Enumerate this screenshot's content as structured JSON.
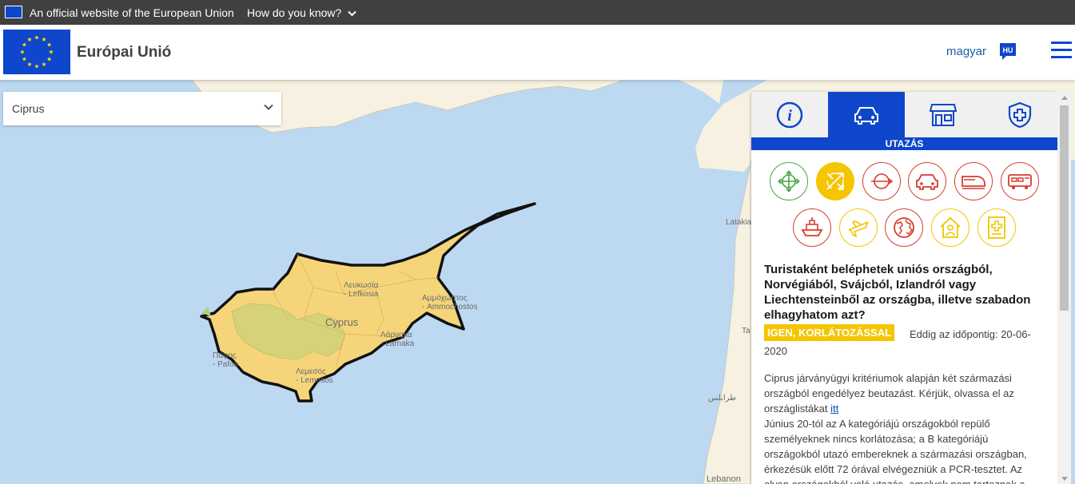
{
  "topbar": {
    "official_text": "An official website of the European Union",
    "how_know": "How do you know?"
  },
  "header": {
    "site_title": "Európai Unió",
    "language": "magyar",
    "language_code": "HU"
  },
  "country_select": {
    "value": "Ciprus"
  },
  "map": {
    "labels": {
      "nicosia": "Λευκωσία\n- Lefkosia",
      "famagusta": "Αμμόχωστος\n- Ammochostos",
      "cyprus": "Cyprus",
      "larnaca": "Λάρνακα\n- Larnaka",
      "paphos": "Πάφος\n- Pafos",
      "limassol": "Λεμεσός\n- Lemesos",
      "latakia": "Latakia",
      "tartus_fragment": "Ta",
      "tripoli_fragment": "طرابلس",
      "lebanon": "Lebanon"
    },
    "colors": {
      "sea": "#bcd9f1",
      "land": "#f6f1e1",
      "highlight": "#f6d57a",
      "forest": "#d6d27a",
      "border": "#111111"
    }
  },
  "panel": {
    "tabs": [
      {
        "name": "info",
        "icon": "info-icon"
      },
      {
        "name": "travel",
        "icon": "car-icon",
        "active": true
      },
      {
        "name": "shops",
        "icon": "store-icon"
      },
      {
        "name": "health",
        "icon": "health-shield-icon"
      }
    ],
    "section_title": "UTAZÁS",
    "categories": [
      {
        "icon": "move-arrows-icon",
        "color": "green"
      },
      {
        "icon": "crossing-arrows-icon",
        "color": "yellow",
        "selected": true
      },
      {
        "icon": "transit-icon",
        "color": "red"
      },
      {
        "icon": "car-icon",
        "color": "red"
      },
      {
        "icon": "train-icon",
        "color": "red"
      },
      {
        "icon": "bus-icon",
        "color": "red"
      },
      {
        "icon": "ship-icon",
        "color": "red"
      },
      {
        "icon": "plane-icon",
        "color": "yellow"
      },
      {
        "icon": "globe-icon",
        "color": "red"
      },
      {
        "icon": "home-person-icon",
        "color": "yellow"
      },
      {
        "icon": "health-document-icon",
        "color": "yellow"
      }
    ],
    "question": "Turistaként beléphetek uniós országból, Norvégiából, Svájcból, Izlandról vagy Liechtensteinből az országba, illetve szabadon elhagyhatom azt?",
    "answer": "IGEN, KORLÁTOZÁSSAL",
    "until_label": "Eddig az időpontig: 20-06-",
    "until_date_end": "2020",
    "body_part1": "Ciprus járványügyi kritériumok alapján két származási országból engedélyez beutazást. Kérjük, olvassa el az országlistákat ",
    "body_link": "itt",
    "body_part2": "Június 20-tól az A kategóriájú országokból repülő személyeknek nincs korlátozása; a B kategóriájú országokból utazó embereknek a származási országban, érkezésük előtt 72 órával elvégezniük a PCR-tesztet. Az olyan országokból való utazás, amelyek nem tartoznak a"
  }
}
